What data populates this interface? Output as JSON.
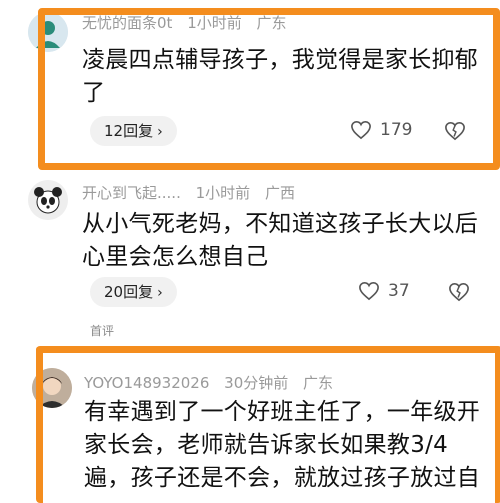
{
  "comments": [
    {
      "username": "无忧的面条0t",
      "time": "1小时前",
      "location": "广东",
      "text_lines": [
        "凌晨四点辅导孩子，我觉得是家长抑郁",
        "了"
      ],
      "reply_label": "12回复",
      "likes": "179",
      "highlighted": true
    },
    {
      "username": "开心到飞起.....",
      "time": "1小时前",
      "location": "广西",
      "text_lines": [
        "从小气死老妈，不知道这孩子长大以后",
        "心里会怎么想自己"
      ],
      "reply_label": "20回复",
      "likes": "37",
      "highlighted": false
    },
    {
      "username": "YOYO148932026",
      "time": "30分钟前",
      "location": "广东",
      "text_lines": [
        "有幸遇到了一个好班主任了，一年级开",
        "家长会，老师就告诉家长如果教3/4",
        "遍，孩子还是不会，就放过孩子放过自"
      ],
      "highlighted": true
    }
  ],
  "section_label": "首评",
  "icons": {
    "reply_chevron": "chevron-right-icon",
    "like": "heart-outline-icon",
    "dislike": "broken-heart-icon"
  },
  "colors": {
    "highlight": "#f48d1e",
    "meta_text": "#9a9a9a",
    "reply_bg": "#f1f1f1"
  }
}
